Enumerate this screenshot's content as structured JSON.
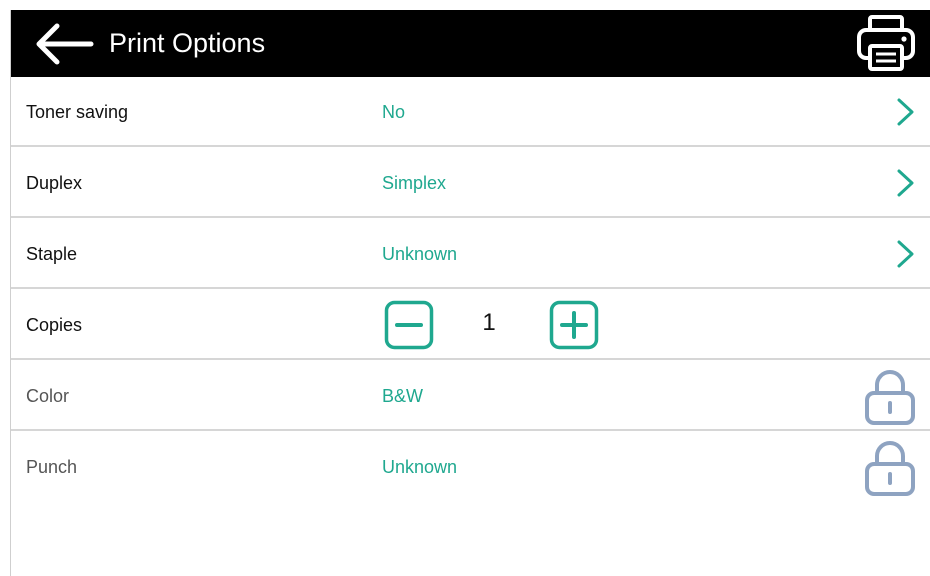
{
  "header": {
    "title": "Print Options",
    "back_icon": "arrow-left-icon",
    "print_icon": "printer-icon"
  },
  "options": [
    {
      "label": "Toner saving",
      "value": "No",
      "state": "editable"
    },
    {
      "label": "Duplex",
      "value": "Simplex",
      "state": "editable"
    },
    {
      "label": "Staple",
      "value": "Unknown",
      "state": "editable"
    },
    {
      "label": "Color",
      "value": "B&W",
      "state": "locked"
    },
    {
      "label": "Punch",
      "value": "Unknown",
      "state": "locked"
    }
  ],
  "copies": {
    "label": "Copies",
    "value": "1",
    "decrement_icon": "minus-icon",
    "increment_icon": "plus-icon"
  },
  "colors": {
    "header_bg": "#000000",
    "accent": "#1fa88f",
    "lock": "#8ea3c1",
    "divider": "#d6d6d6"
  }
}
